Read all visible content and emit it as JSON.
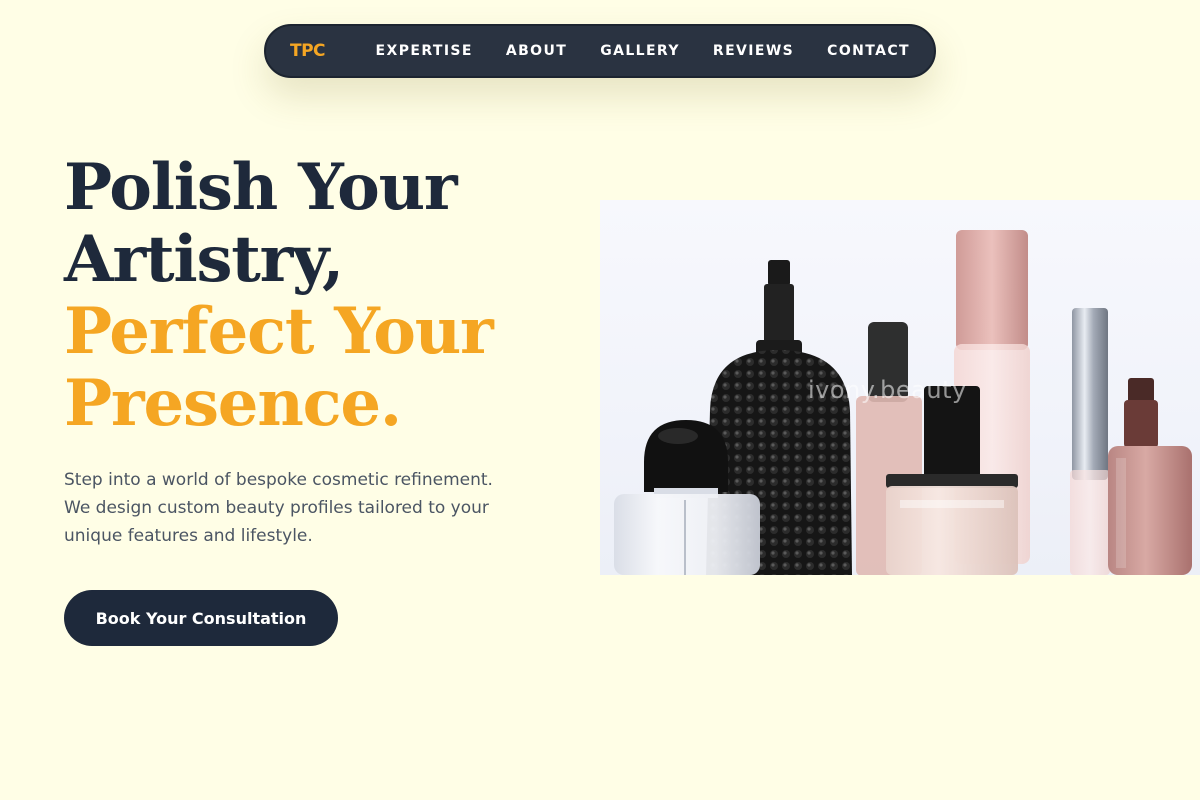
{
  "nav": {
    "logo": "TPC",
    "links": [
      "EXPERTISE",
      "ABOUT",
      "GALLERY",
      "REVIEWS",
      "CONTACT"
    ]
  },
  "hero": {
    "headline": {
      "line1": "Polish Your",
      "line2": "Artistry,",
      "line3": "Perfect Your",
      "line4": "Presence."
    },
    "description": "Step into a world of bespoke cosmetic refinement. We design custom beauty profiles tailored to your unique features and lifestyle.",
    "cta_label": "Book Your Consultation",
    "image": {
      "watermark": "ivony.beauty",
      "subject": "perfume-bottles"
    }
  },
  "colors": {
    "background": "#fffee6",
    "nav_background": "#2a3341",
    "accent": "#f5a623",
    "dark_text": "#1e293b",
    "body_text": "#4b5563"
  }
}
